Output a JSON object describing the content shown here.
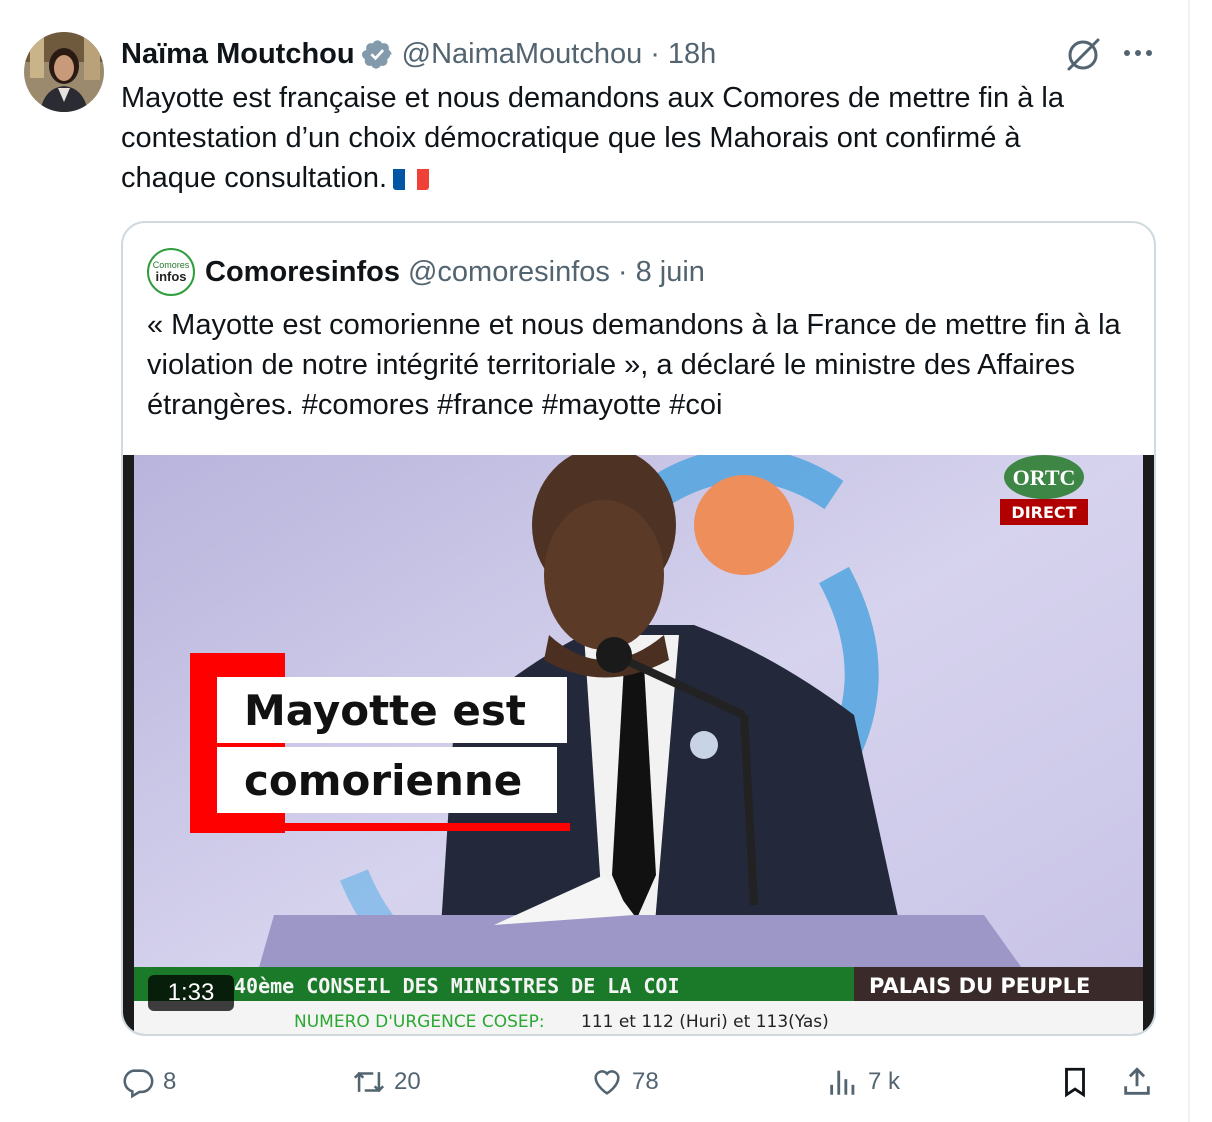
{
  "tweet": {
    "author_name": "Naïma Moutchou",
    "author_handle": "@NaimaMoutchou",
    "separator": "·",
    "time": "18h",
    "text": "Mayotte est française et nous demandons aux Comores de mettre fin à la\ncontestation d’un choix démocratique que les Mahorais ont confirmé à\nchaque consultation.",
    "flag": "french-flag-emoji",
    "flag_colors": [
      "#0055a4",
      "#ffffff",
      "#ef4135"
    ]
  },
  "quote": {
    "logo_line1": "Comores",
    "logo_line2": "infos",
    "author_name": "Comoresinfos",
    "author_handle": "@comoresinfos",
    "separator": "·",
    "date": "8 juin",
    "text": "« Mayotte est comorienne et nous demandons à la France de mettre fin à la violation de notre intégrité territoriale », a déclaré le ministre des Affaires étrangères. #comores #france #mayotte #coi",
    "video": {
      "caption_line1": "Mayotte est",
      "caption_line2": "comorienne",
      "broadcaster": "ORTC",
      "live_badge": "DIRECT",
      "ticker_left": "40ème CONSEIL DES MINISTRES DE LA COI",
      "ticker_right": "PALAIS DU PEUPLE",
      "emergency_label": "NUMERO D'URGENCE COSEP:",
      "emergency_numbers": "111 et 112 (Huri) et 113(Yas)",
      "duration": "1:33"
    }
  },
  "actions": {
    "replies": "8",
    "retweets": "20",
    "likes": "78",
    "views": "7 k"
  },
  "colors": {
    "text_primary": "#0f1419",
    "text_secondary": "#536471",
    "verified_badge": "#829aab",
    "border": "#cfd9de",
    "caption_red": "#ff0000"
  },
  "icons": [
    "verified-badge-icon",
    "grok-icon",
    "more-icon",
    "reply-icon",
    "retweet-icon",
    "like-icon",
    "views-icon",
    "bookmark-icon",
    "share-icon"
  ]
}
